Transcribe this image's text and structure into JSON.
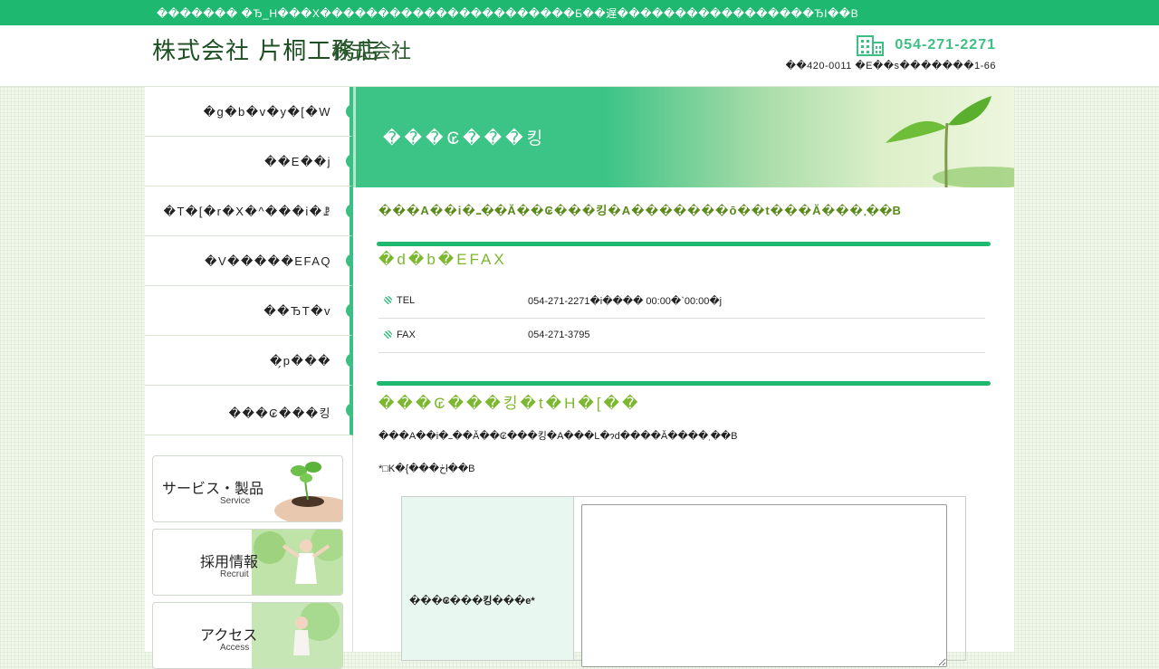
{
  "topbar": {
    "text": "������� �Ђ_H���X����������������������Б��遅�����������������ЂI��B"
  },
  "header": {
    "logo": "株式会社 片桐工務店",
    "logo_overlay": "株式会社",
    "phone": "054-271-2271",
    "address": "��420-0011 �E��s�������1-66"
  },
  "sidebar": {
    "items": [
      {
        "label": "�g�b�v�y�[�W"
      },
      {
        "label": "��E��j"
      },
      {
        "label": "�T�[�r�X�^���i�ꗗ"
      },
      {
        "label": "�V�����EFAQ"
      },
      {
        "label": "��ЂT�v"
      },
      {
        "label": "�̗p���"
      },
      {
        "label": "���₢���킹"
      }
    ],
    "banners": [
      {
        "title": "サービス・製品",
        "sub": "Service"
      },
      {
        "title": "採用情報",
        "sub": "Recruit"
      },
      {
        "title": "アクセス",
        "sub": "Access"
      }
    ]
  },
  "main": {
    "hero_title": "���₢���킹",
    "intro": "���A��i�ߺ��Ă��₢���킹�A�������ō��t���Ă���܂��B",
    "tel_fax_heading": "�d�b�EFAX",
    "tel_label": "TEL",
    "tel_value": "054-271-2271�i���� 00:00�`00:00�j",
    "fax_label": "FAX",
    "fax_value": "054-271-3795",
    "form_heading": "���₢���킹�t�H�[��",
    "form_para1": "���A��i�ߺ��Ă��₢���킹�A���L�ɂd����Ă����܂��B",
    "form_para2": "*□K�{���ڂł��B",
    "form_label": "���₢���킹���e*"
  }
}
